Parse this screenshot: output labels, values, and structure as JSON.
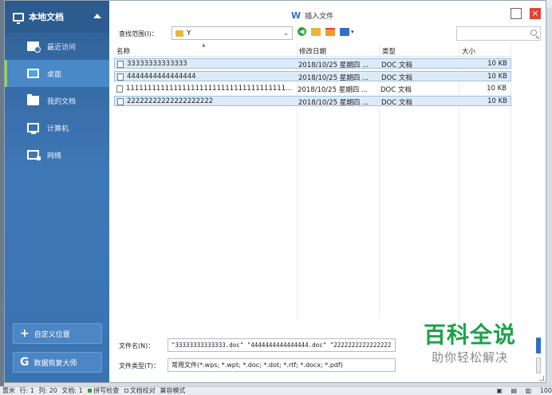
{
  "sidebar": {
    "header": "本地文档",
    "items": [
      {
        "label": "最近访问",
        "icon": "recent-docs-icon"
      },
      {
        "label": "桌面",
        "icon": "desktop-icon"
      },
      {
        "label": "我的文档",
        "icon": "folder-icon"
      },
      {
        "label": "计算机",
        "icon": "computer-icon"
      },
      {
        "label": "网络",
        "icon": "network-icon"
      }
    ],
    "custom_location_label": "自定义位置",
    "recover_label": "数据恢复大师"
  },
  "dialog": {
    "title": "插入文件",
    "lookin_label": "查找范围(I)：",
    "lookin_value": "Y",
    "search_placeholder": ""
  },
  "filelist": {
    "columns": [
      "名称",
      "修改日期",
      "类型",
      "大小"
    ],
    "rows": [
      {
        "name": "33333333333333",
        "date": "2018/10/25 星期四 ...",
        "type": "DOC 文档",
        "size": "10 KB",
        "selected": true
      },
      {
        "name": "4444444444444444",
        "date": "2018/10/25 星期四 ...",
        "type": "DOC 文档",
        "size": "10 KB",
        "selected": true
      },
      {
        "name": "1111111111111111111111111111111111111...",
        "date": "2018/10/25 星期四 ...",
        "type": "DOC 文档",
        "size": "10 KB",
        "selected": false
      },
      {
        "name": "22222222222222222222",
        "date": "2018/10/25 星期四 ...",
        "type": "DOC 文档",
        "size": "10 KB",
        "selected": true
      }
    ]
  },
  "filename": {
    "label": "文件名(N)：",
    "value": "\"33333333333333.doc\" \"4444444444444444.doc\" \"2222222222222222"
  },
  "filetype": {
    "label": "文件类型(T)：",
    "value": "常用文件(*.wps; *.wpt; *.doc; *.dot; *.rtf; *.docx; *.pdf)"
  },
  "watermark": {
    "title": "百科全说",
    "subtitle": "助你轻松解决"
  },
  "statusbar": {
    "items": [
      "置米",
      "行: 1",
      "列: 20",
      "文档: 1"
    ],
    "check1": "拼写检查",
    "check2": "文档校对",
    "mode": "兼容模式",
    "zoom": "100"
  },
  "colors": {
    "sidebar": "#3b73b1",
    "accent_green": "#1ba24a",
    "selection": "#ddeaf7"
  }
}
